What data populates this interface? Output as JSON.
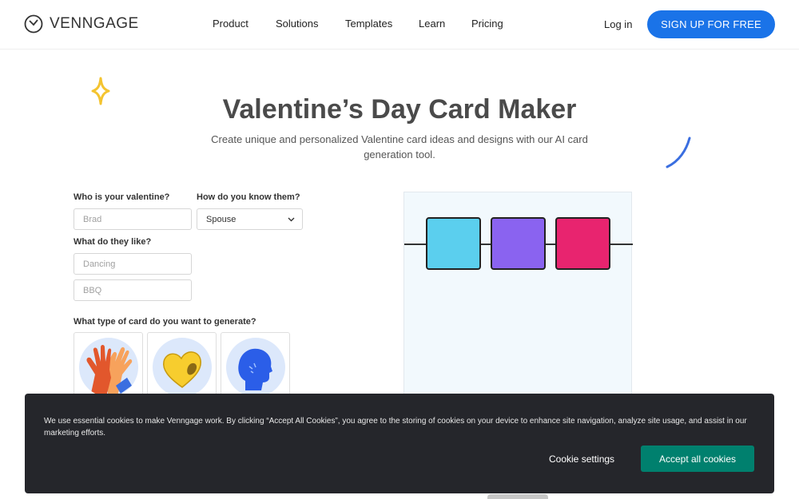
{
  "header": {
    "logo_text": "VENNGAGE",
    "nav": [
      "Product",
      "Solutions",
      "Templates",
      "Learn",
      "Pricing"
    ],
    "login_label": "Log in",
    "signup_label": "SIGN UP FOR FREE",
    "signup_color": "#1a73e8"
  },
  "hero": {
    "title": "Valentine’s Day Card Maker",
    "subtitle": "Create unique and personalized Valentine card ideas and designs with our AI card generation tool."
  },
  "form": {
    "who_label": "Who is your valentine?",
    "who_placeholder": "Brad",
    "know_label": "How do you know them?",
    "know_value": "Spouse",
    "like_label": "What do they like?",
    "like_placeholder_1": "Dancing",
    "like_placeholder_2": "BBQ",
    "type_label": "What type of card do you want to generate?",
    "card_types": [
      {
        "icon": "high-five-icon"
      },
      {
        "icon": "heart-icon"
      },
      {
        "icon": "head-profile-icon"
      }
    ]
  },
  "preview": {
    "squares": [
      "#5bcfee",
      "#8a63f0",
      "#e8246f"
    ]
  },
  "cookie": {
    "text": "We use essential cookies to make Venngage work. By clicking “Accept All Cookies”, you agree to the storing of cookies on your device to enhance site navigation, analyze site usage, and assist in our marketing efforts.",
    "settings_label": "Cookie settings",
    "accept_label": "Accept all cookies",
    "accept_color": "#00806e"
  }
}
